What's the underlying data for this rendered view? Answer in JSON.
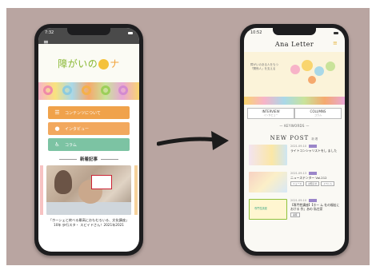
{
  "left_phone": {
    "status": {
      "time": "7:32"
    },
    "logo": {
      "text_a": "障がいの",
      "text_b": "ナ"
    },
    "menu": [
      {
        "label": "コンテンツについて",
        "icon": "list-icon"
      },
      {
        "label": "インタビュー",
        "icon": "microphone-icon"
      },
      {
        "label": "コラム",
        "icon": "wheelchair-icon"
      }
    ],
    "section_title": "新着記事",
    "article_caption": "「ホーシェと終べる最高におもむろいる、文化講座」10年 歩行スタ・ スビイドさん！2021年2021"
  },
  "right_phone": {
    "status": {
      "time": "10:52"
    },
    "brand": "Ana Letter",
    "hero_text": "障がいのある人をもつ「関係人」を支える",
    "tabs": [
      {
        "label": "INTERVIEW",
        "sub": "インタビュー"
      },
      {
        "label": "COLUMNS",
        "sub": "コラム"
      }
    ],
    "keywords": "— KEYWORDS —",
    "new_post": {
      "label": "NEW POST",
      "jp": "新着"
    },
    "posts": [
      {
        "date": "2021.09.10",
        "title": "ライトコンシャリストをし ました",
        "chips": [],
        "thumb_title": ""
      },
      {
        "date": "2021.09.13",
        "title": "ニューステンター Vol.212",
        "chips": [
          "ニュース",
          "お知らせ",
          "イベント"
        ],
        "thumb_title": ""
      },
      {
        "date": "2021.09.10",
        "title": "【専門性講座】【ホー ム 社の福祉における 作」あの 私住家",
        "chips": [
          "講座"
        ],
        "thumb_title": "専門性講座"
      }
    ]
  },
  "colors": {
    "background": "#b9a5a1",
    "accent_orange": "#f0a24b",
    "accent_green": "#7cc3a3",
    "brand_yellow": "#e4b43c"
  }
}
